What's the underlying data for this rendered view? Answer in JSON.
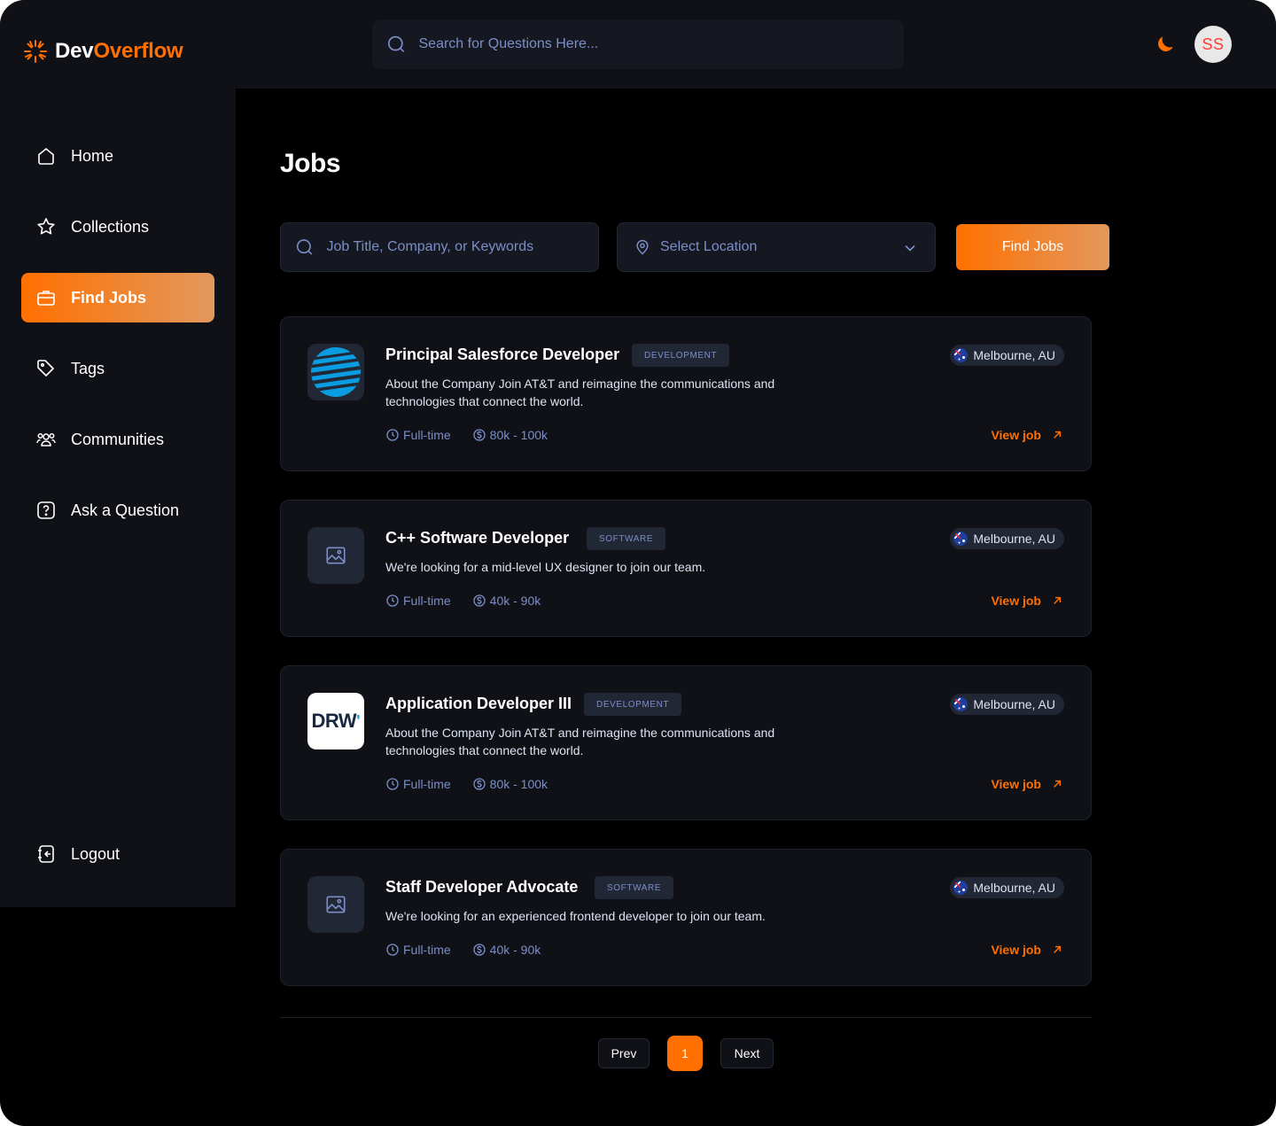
{
  "brand": {
    "name_part1": "Dev",
    "name_part2": "Overflow",
    "accent": "#ff7000"
  },
  "header": {
    "search_placeholder": "Search for Questions Here...",
    "theme_icon": "moon-icon",
    "avatar_initials": "SS"
  },
  "sidebar": {
    "items": [
      {
        "label": "Home",
        "icon": "home-icon",
        "active": false
      },
      {
        "label": "Collections",
        "icon": "star-icon",
        "active": false
      },
      {
        "label": "Find Jobs",
        "icon": "briefcase-icon",
        "active": true
      },
      {
        "label": "Tags",
        "icon": "tag-icon",
        "active": false
      },
      {
        "label": "Communities",
        "icon": "users-icon",
        "active": false
      },
      {
        "label": "Ask a Question",
        "icon": "question-icon",
        "active": false
      }
    ],
    "logout_label": "Logout"
  },
  "main": {
    "title": "Jobs",
    "job_search_placeholder": "Job Title, Company, or Keywords",
    "location_placeholder": "Select Location",
    "find_button": "Find Jobs"
  },
  "jobs": [
    {
      "title": "Principal Salesforce Developer",
      "tag": "DEVELOPMENT",
      "description": "About the Company Join AT&T and reimagine the communications and technologies that connect the world.",
      "employment": "Full-time",
      "salary": "80k - 100k",
      "location": "Melbourne, AU",
      "view_label": "View job",
      "logo": "att"
    },
    {
      "title": "C++ Software Developer",
      "tag": "SOFTWARE",
      "description": "We're looking for a mid-level UX designer to join our team.",
      "employment": "Full-time",
      "salary": "40k - 90k",
      "location": "Melbourne, AU",
      "view_label": "View job",
      "logo": "placeholder"
    },
    {
      "title": "Application Developer III",
      "tag": "DEVELOPMENT",
      "description": "About the Company Join AT&T and reimagine the communications and technologies that connect the world.",
      "employment": "Full-time",
      "salary": "80k - 100k",
      "location": "Melbourne, AU",
      "view_label": "View job",
      "logo": "drw",
      "logo_text": "DRW"
    },
    {
      "title": "Staff Developer Advocate",
      "tag": "SOFTWARE",
      "description": "We're looking for an experienced frontend developer to join our team.",
      "employment": "Full-time",
      "salary": "40k - 90k",
      "location": "Melbourne, AU",
      "view_label": "View job",
      "logo": "placeholder"
    }
  ],
  "pagination": {
    "prev": "Prev",
    "current": "1",
    "next": "Next"
  }
}
